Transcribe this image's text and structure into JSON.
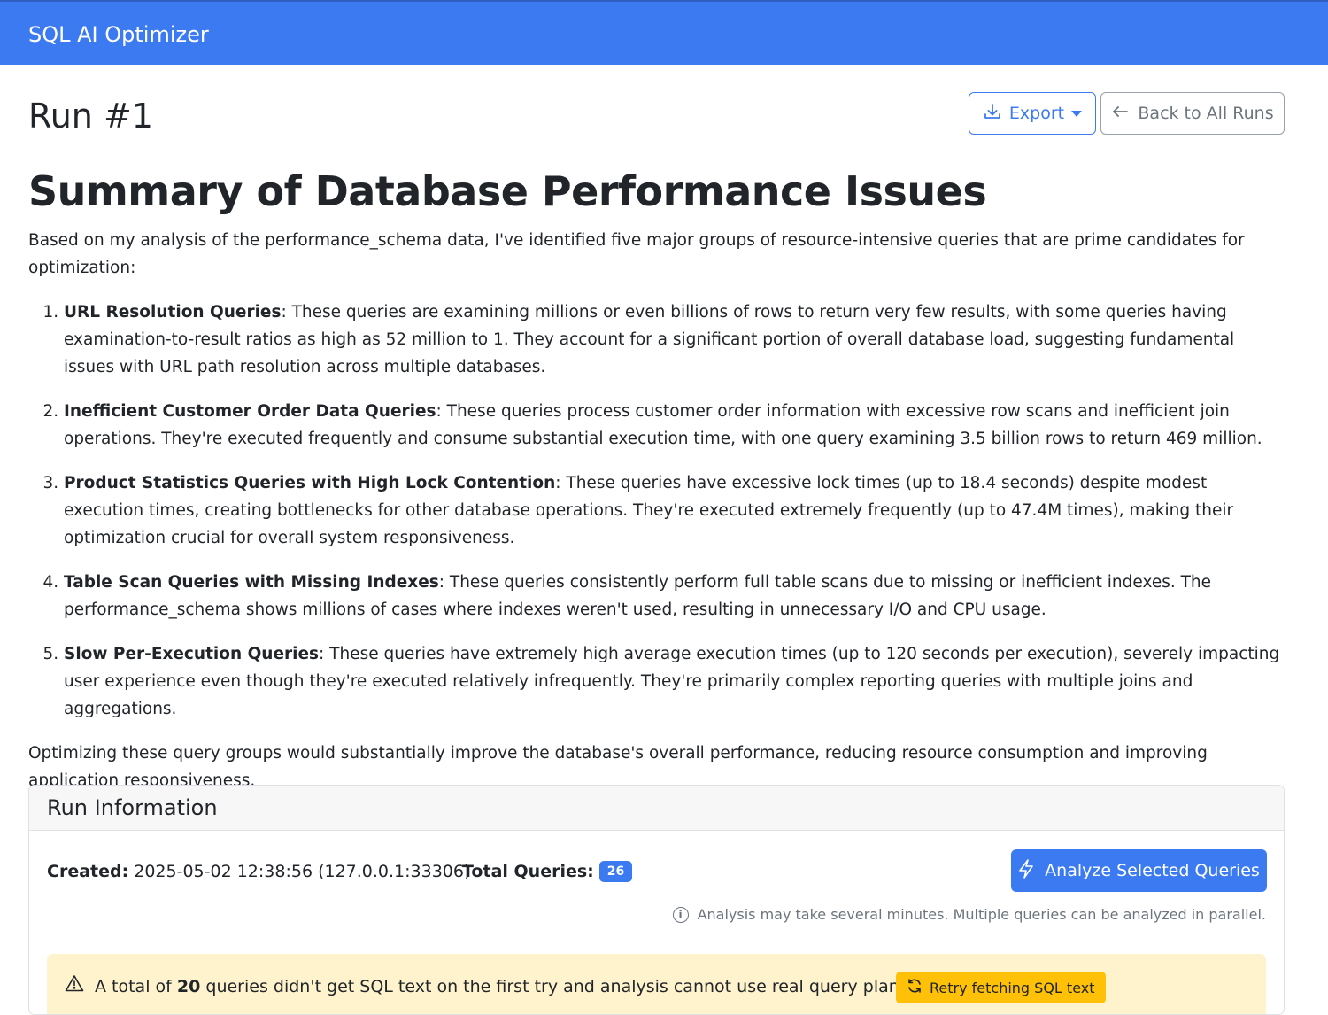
{
  "navbar": {
    "brand": "SQL AI Optimizer"
  },
  "header": {
    "title": "Run #1",
    "export_label": "Export",
    "back_label": "Back to All Runs"
  },
  "summary": {
    "heading": "Summary of Database Performance Issues",
    "intro": "Based on my analysis of the performance_schema data, I've identified five major groups of resource-intensive queries that are prime candidates for optimization:",
    "items": [
      {
        "title": "URL Resolution Queries",
        "text": ": These queries are examining millions or even billions of rows to return very few results, with some queries having examination-to-result ratios as high as 52 million to 1. They account for a significant portion of overall database load, suggesting fundamental issues with URL path resolution across multiple databases."
      },
      {
        "title": "Inefficient Customer Order Data Queries",
        "text": ": These queries process customer order information with excessive row scans and inefficient join operations. They're executed frequently and consume substantial execution time, with one query examining 3.5 billion rows to return 469 million."
      },
      {
        "title": "Product Statistics Queries with High Lock Contention",
        "text": ": These queries have excessive lock times (up to 18.4 seconds) despite modest execution times, creating bottlenecks for other database operations. They're executed extremely frequently (up to 47.4M times), making their optimization crucial for overall system responsiveness."
      },
      {
        "title": "Table Scan Queries with Missing Indexes",
        "text": ": These queries consistently perform full table scans due to missing or inefficient indexes. The performance_schema shows millions of cases where indexes weren't used, resulting in unnecessary I/O and CPU usage."
      },
      {
        "title": "Slow Per-Execution Queries",
        "text": ": These queries have extremely high average execution times (up to 120 seconds per execution), severely impacting user experience even though they're executed relatively infrequently. They're primarily complex reporting queries with multiple joins and aggregations."
      }
    ],
    "conclusion": "Optimizing these query groups would substantially improve the database's overall performance, reducing resource consumption and improving application responsiveness."
  },
  "run_info": {
    "heading": "Run Information",
    "created_label": "Created:",
    "created_value": "2025-05-02 12:38:56 (127.0.0.1:33306)",
    "total_label": "Total Queries:",
    "total_value": "26",
    "analyze_label": "Analyze Selected Queries",
    "note": "Analysis may take several minutes. Multiple queries can be analyzed in parallel.",
    "alert_prefix": "A total of",
    "alert_count": "20",
    "alert_suffix": "queries didn't get SQL text on the first try and analysis cannot use real query plan data.",
    "retry_label": "Retry fetching SQL text"
  },
  "colors": {
    "primary": "#3b7af0",
    "warning_bg": "#fff3cd",
    "warning_button": "#ffc107",
    "secondary": "#6c757d"
  },
  "icons": [
    "download-icon",
    "caret-down-icon",
    "arrow-left-icon",
    "lightning-icon",
    "info-circle-icon",
    "warning-triangle-icon",
    "refresh-icon"
  ]
}
